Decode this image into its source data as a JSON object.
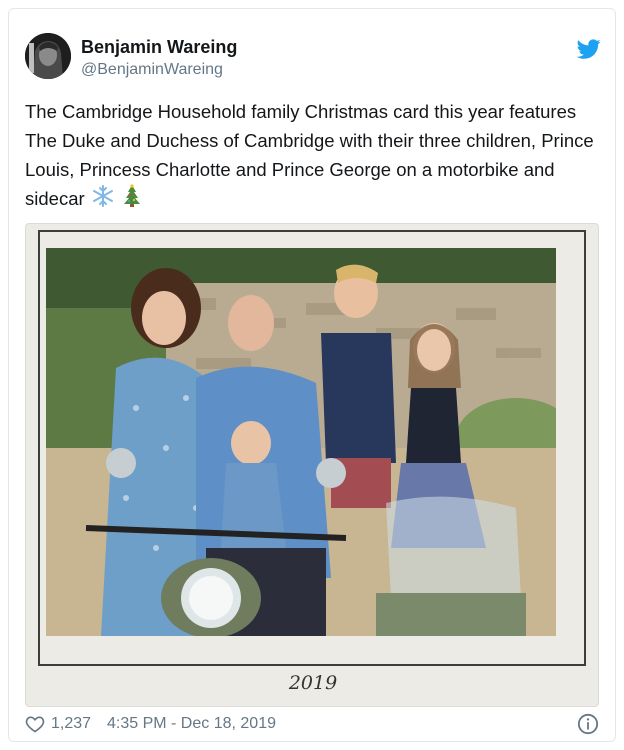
{
  "author": {
    "name": "Benjamin Wareing",
    "handle": "@BenjaminWareing"
  },
  "tweet": {
    "text": "The Cambridge Household family Christmas card this year features The Duke and Duchess of Cambridge with their three children, Prince Louis, Princess Charlotte and Prince George on a motorbike and sidecar",
    "emojis": [
      "snowflake-icon",
      "christmas-tree-icon"
    ]
  },
  "media": {
    "card_year": "2019"
  },
  "footer": {
    "likes": "1,237",
    "timestamp": "4:35 PM - Dec 18, 2019"
  },
  "colors": {
    "twitter_blue": "#1da1f2",
    "secondary_text": "#657786",
    "border": "#e1e8ed"
  }
}
